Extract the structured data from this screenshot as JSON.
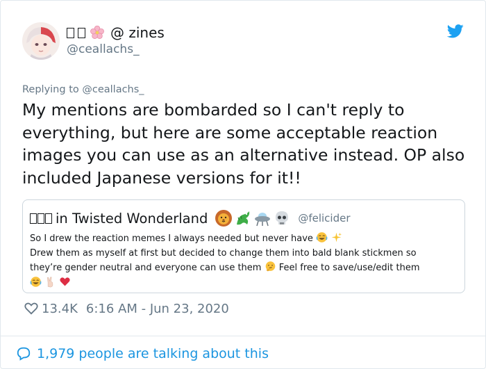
{
  "author": {
    "name_prefix_glyphs": 2,
    "name_text": "@ zines",
    "handle": "@ceallachs_",
    "avatar_icon": "anime-avatar"
  },
  "replying_to": "Replying to @ceallachs_",
  "tweet_text": "My mentions are bombarded so I can't reply to everything, but here are some acceptable reaction images you can use as an alternative instead. OP also included Japanese versions for it!!",
  "quoted": {
    "name_prefix_glyphs": 3,
    "name_text": "in Twisted Wonderland",
    "handle": "@felicider",
    "line1": "So I drew the reaction memes I always needed but never have",
    "line2": "Drew them as myself at first but decided to change them into bald blank stickmen so",
    "line3a": "they’re gender neutral and everyone can use them",
    "line3b": "Feel free to save/use/edit them"
  },
  "footer": {
    "likes": "13.4K",
    "timestamp": "6:16 AM - Jun 23, 2020",
    "talking": "1,979 people are talking about this"
  },
  "colors": {
    "link_blue": "#1b95e0",
    "muted": "#657786",
    "text": "#14171a",
    "border": "#e1e8ed"
  }
}
